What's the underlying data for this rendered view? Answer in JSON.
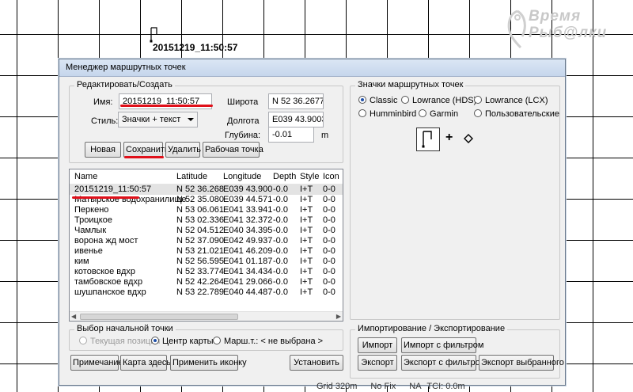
{
  "map": {
    "waypoint_label": "20151219_11:50:57",
    "logo_line1": "Время",
    "logo_line2": "Рыб@лки",
    "status": [
      "Grid 320m",
      "No Fix",
      "NA",
      "TCI: 0.0m"
    ]
  },
  "dialog": {
    "title": "Менеджер маршрутных точек",
    "edit": {
      "group_title": "Редактировать/Создать",
      "name_label": "Имя:",
      "name_value": "20151219_11:50:57",
      "style_label": "Стиль:",
      "style_value": "Значки + текст",
      "lat_label": "Широта",
      "lat_value": "N 52 36.2677",
      "lon_label": "Долгота",
      "lon_value": "E039 43.9003",
      "depth_label": "Глубина:",
      "depth_value": "-0.01",
      "depth_unit": "m",
      "buttons": {
        "new": "Новая",
        "save": "Сохранить",
        "delete": "Удалить",
        "working": "Рабочая точка"
      }
    },
    "list": {
      "headers": [
        "Name",
        "Latitude",
        "Longitude",
        "Depth",
        "Style",
        "Icon"
      ],
      "rows": [
        [
          "20151219_11:50:57",
          "N 52 36.268",
          "E039 43.900",
          "-0.0",
          "I+T",
          "0-0"
        ],
        [
          "Матырское водохранилище",
          "N 52 35.080",
          "E039 44.571",
          "-0.0",
          "I+T",
          "0-0"
        ],
        [
          "Перкено",
          "N 53 06.061",
          "E041 33.941",
          "-0.0",
          "I+T",
          "0-0"
        ],
        [
          "Троицкое",
          "N 53 02.336",
          "E041 32.372",
          "-0.0",
          "I+T",
          "0-0"
        ],
        [
          "Чамлык",
          "N 52 04.512",
          "E040 34.395",
          "-0.0",
          "I+T",
          "0-0"
        ],
        [
          "ворона жд мост",
          "N 52 37.090",
          "E042 49.937",
          "-0.0",
          "I+T",
          "0-0"
        ],
        [
          "ивенье",
          "N 53 21.021",
          "E041 46.209",
          "-0.0",
          "I+T",
          "0-0"
        ],
        [
          "ким",
          "N 52 56.595",
          "E041 01.187",
          "-0.0",
          "I+T",
          "0-0"
        ],
        [
          "котовское вдхр",
          "N 52 33.774",
          "E041 34.434",
          "-0.0",
          "I+T",
          "0-0"
        ],
        [
          "тамбовское вдхр",
          "N 52 42.264",
          "E041 29.066",
          "-0.0",
          "I+T",
          "0-0"
        ],
        [
          "шушпанское вдхр",
          "N 53 22.789",
          "E040 44.487",
          "-0.0",
          "I+T",
          "0-0"
        ]
      ]
    },
    "start": {
      "group_title": "Выбор начальной точки",
      "current": "Текущая позиция",
      "center": "Центр карты",
      "route": "Марш.т.: < не выбрана >"
    },
    "bottom": {
      "note": "Примечание",
      "map_here": "Карта здесь",
      "apply_icon": "Применить иконку",
      "install": "Установить"
    },
    "icons": {
      "group_title": "Значки маршрутных точек",
      "options": [
        "Classic",
        "Lowrance (HDS)",
        "Lowrance (LCX)",
        "Humminbird",
        "Garmin",
        "Пользовательские"
      ],
      "selected": "Classic"
    },
    "io": {
      "group_title": "Импортирование / Экспортирование",
      "import": "Импорт",
      "import_filter": "Импорт с фильтром",
      "export": "Экспорт",
      "export_filter": "Экспорт с фильтром",
      "export_selected": "Экспорт выбранного"
    },
    "accent_color": "#e0101a"
  }
}
